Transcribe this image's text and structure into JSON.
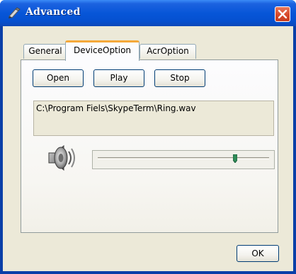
{
  "window": {
    "title": "Advanced"
  },
  "tabs": [
    {
      "label": "General",
      "active": false
    },
    {
      "label": "DeviceOption",
      "active": true
    },
    {
      "label": "AcrOption",
      "active": false
    }
  ],
  "device": {
    "open_label": "Open",
    "play_label": "Play",
    "stop_label": "Stop",
    "file_path": "C:\\Program Fiels\\SkypeTerm\\Ring.wav",
    "volume_level": 0.8
  },
  "footer": {
    "ok_label": "OK"
  },
  "colors": {
    "title_bar": "#0756d8",
    "close_button": "#d8482a",
    "active_tab_accent": "#f5a93a",
    "slider_thumb": "#2e8b57"
  },
  "icons": [
    "pen-icon",
    "close-icon",
    "speaker-icon"
  ]
}
